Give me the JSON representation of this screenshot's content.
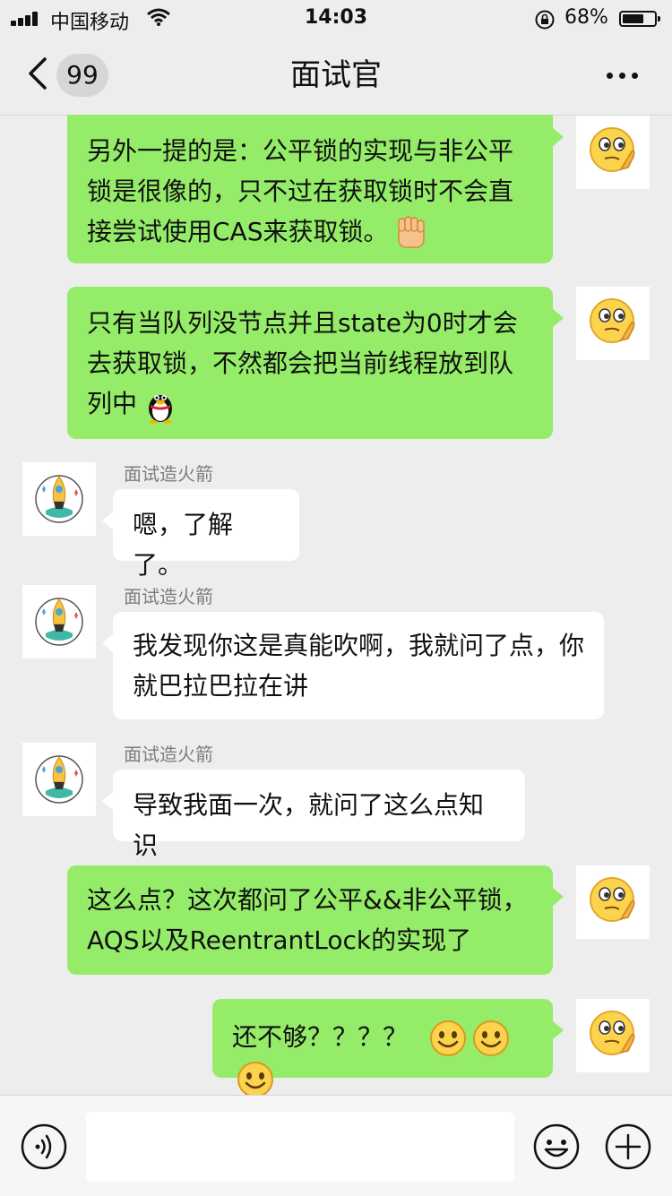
{
  "status": {
    "carrier": "中国移动",
    "time": "14:03",
    "battery": "68%",
    "battery_level": 0.68
  },
  "nav": {
    "back_count": "99",
    "title": "面试官"
  },
  "messages": [
    {
      "side": "right",
      "text": "另外一提的是：公平锁的实现与非公平锁是很像的，只不过在获取锁时不会直接尝试使用CAS来获取锁。",
      "emoji": "fist-emoji"
    },
    {
      "side": "right",
      "text": "只有当队列没节点并且state为0时才会去获取锁，不然都会把当前线程放到队列中",
      "emoji": "penguin-emoji"
    },
    {
      "side": "left",
      "sender": "面试造火箭",
      "text": "嗯，了解了。"
    },
    {
      "side": "left",
      "sender": "面试造火箭",
      "text": "我发现你这是真能吹啊，我就问了点，你就巴拉巴拉在讲"
    },
    {
      "side": "left",
      "sender": "面试造火箭",
      "text": "导致我面一次，就问了这么点知识"
    },
    {
      "side": "right",
      "text": "这么点？这次都问了公平&&非公平锁，AQS以及ReentrantLock的实现了"
    },
    {
      "side": "right",
      "text": "还不够？？？？",
      "emoji": "smile-emoji x3"
    }
  ],
  "input": {
    "placeholder": ""
  },
  "icons": {
    "voice": "voice-icon",
    "emoji": "emoji-icon",
    "plus": "plus-icon",
    "self_avatar": "thinking-emoji-avatar",
    "other_avatar": "rocket-avatar"
  },
  "colors": {
    "sent_bubble": "#95ec69",
    "received_bubble": "#ffffff",
    "background": "#ededed"
  }
}
